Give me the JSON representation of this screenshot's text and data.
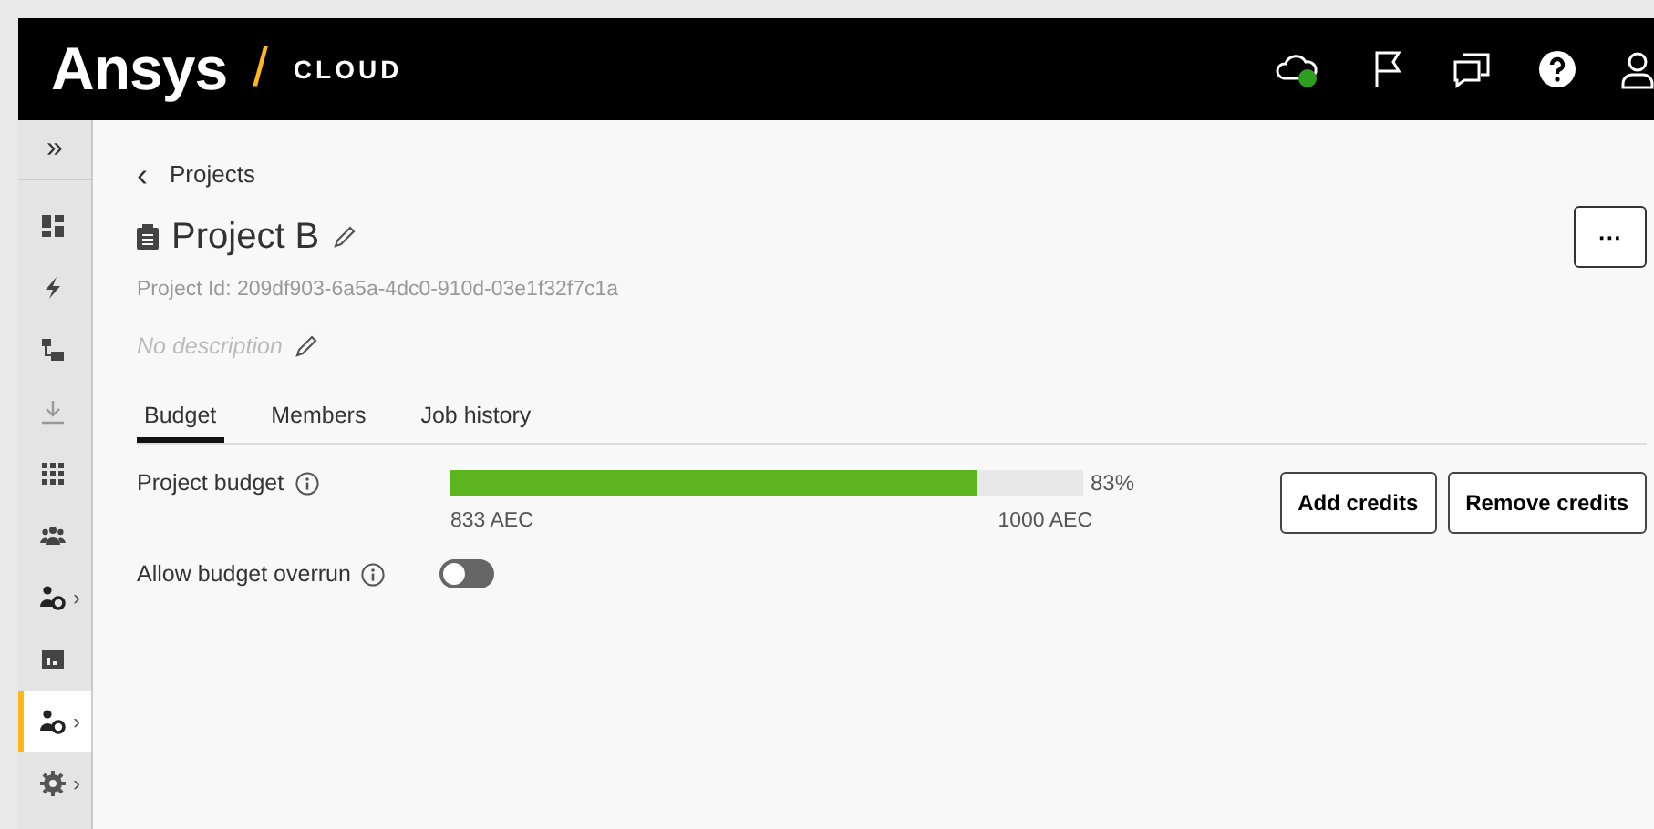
{
  "header": {
    "logo": "Ansys",
    "separator": "/",
    "product": "CLOUD"
  },
  "sidebar": {
    "toggle": "»",
    "items": [
      {
        "selected": false
      },
      {
        "selected": false
      },
      {
        "selected": false
      },
      {
        "selected": false
      },
      {
        "selected": false
      },
      {
        "selected": false
      },
      {
        "selected": false,
        "arrow": "›"
      },
      {
        "selected": false
      },
      {
        "selected": true,
        "arrow": "›"
      },
      {
        "selected": false,
        "arrow": "›"
      }
    ]
  },
  "breadcrumb": {
    "back": "‹",
    "label": "Projects"
  },
  "title": "Project B",
  "more": "···",
  "project_id": "Project Id: 209df903-6a5a-4dc0-910d-03e1f32f7c1a",
  "description": "No description",
  "tabs": [
    {
      "label": "Budget",
      "selected": true
    },
    {
      "label": "Members",
      "selected": false
    },
    {
      "label": "Job history",
      "selected": false
    }
  ],
  "budget": {
    "label": "Project budget",
    "level": 0.833,
    "percent": "83%",
    "used": "833 AEC",
    "total": "1000 AEC"
  },
  "buttons": [
    "Add credits",
    "Remove credits"
  ],
  "overrun": {
    "label": "Allow budget overrun",
    "on": false
  }
}
